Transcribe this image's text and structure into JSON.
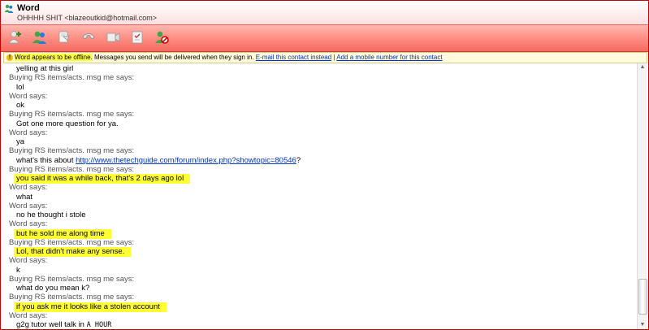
{
  "window": {
    "title": "Word",
    "subtitle": "OHHHH SHIT <blazeoutkid@hotmail.com>"
  },
  "toolbar": {
    "icons": [
      "invite-contact-icon",
      "contacts-icon",
      "send-file-icon",
      "call-icon",
      "video-icon",
      "activities-icon",
      "block-icon"
    ]
  },
  "notice": {
    "offline_text": "Word appears to be offline.",
    "delivery_text": "Messages you send will be delivered when they sign in.",
    "email_link": "E-mail this contact instead",
    "separator": "|",
    "mobile_link": "Add a mobile number for this contact"
  },
  "conversation": {
    "top_partial_text": "yelling at this girl",
    "messages": [
      {
        "sender": "Buying RS items/acts. msg me says:",
        "text": "lol"
      },
      {
        "sender": "Word says:",
        "text": "ok"
      },
      {
        "sender": "Buying RS items/acts. msg me says:",
        "text": "Got one more question for ya."
      },
      {
        "sender": "Word says:",
        "text": "ya"
      },
      {
        "sender": "Buying RS items/acts. msg me says:",
        "text_prefix": "what's this about ",
        "link": "http://www.thetechguide.com/forum/index.php?showtopic=80546",
        "text_suffix": "?"
      },
      {
        "sender": "Buying RS items/acts. msg me says:",
        "text": "you said it was a while back, that's 2 days ago lol",
        "highlight": true
      },
      {
        "sender": "Word says:",
        "text": "what"
      },
      {
        "sender": "Word says:",
        "text": "no he thought i stole"
      },
      {
        "sender": "Word says:",
        "text": "but he sold me along time",
        "highlight": true
      },
      {
        "sender": "Buying RS items/acts. msg me says:",
        "text": "Lol, that didn't make any sense.",
        "highlight": true
      },
      {
        "sender": "Word says:",
        "text": "k"
      },
      {
        "sender": "Buying RS items/acts. msg me says:",
        "text": "what do you mean k?"
      },
      {
        "sender": "Buying RS items/acts. msg me says:",
        "text": "if you ask me it looks like a stolen account",
        "highlight": true
      },
      {
        "sender": "Word says:",
        "text_prefix": "g2g tutor well talk in ",
        "text_mono": "A HOUR"
      }
    ]
  },
  "colors": {
    "highlight": "#ffff33",
    "link": "#0033cc",
    "window_border": "#c40000",
    "toolbar": "#ff8e84"
  }
}
